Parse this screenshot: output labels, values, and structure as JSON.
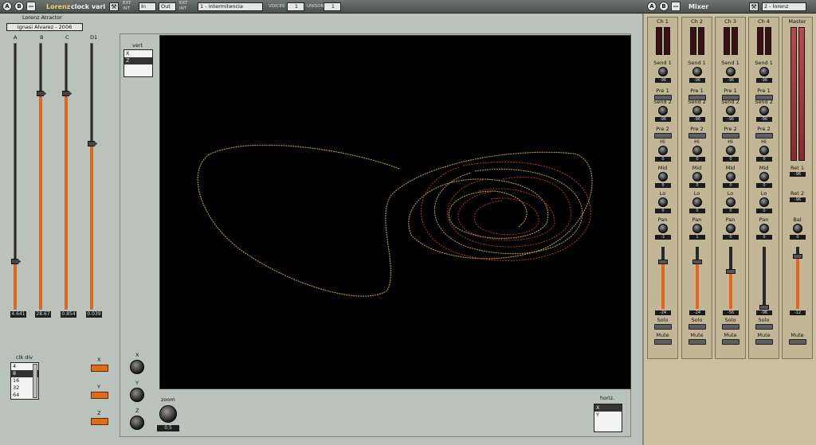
{
  "lorenz": {
    "title": "Lorenz",
    "title_suffix": "clock vari",
    "in_label": "In",
    "out_label": "Out",
    "ext": "EXT",
    "int": "INT",
    "patch": "1 - intermitencia",
    "voices_label": "VOICES",
    "voices": "1",
    "unison_label": "UNISON",
    "unison": "1",
    "panel_title": "Lorenz Atractor",
    "author": "Ignasi Alvarez - 2006",
    "params": [
      {
        "label": "A",
        "value": "4.641",
        "level": 0.18
      },
      {
        "label": "B",
        "value": "28.67",
        "level": 0.81
      },
      {
        "label": "C",
        "value": "0.854",
        "level": 0.81
      },
      {
        "label": "D1",
        "value": "0.039",
        "level": 0.62
      }
    ],
    "clk_div_label": "clk div",
    "clk_div_options": [
      "4",
      "8",
      "16",
      "32",
      "64"
    ],
    "clk_div_selected": 1,
    "x_label": "X",
    "y_label": "Y",
    "z_label": "Z",
    "vert_label": "vert",
    "vert_options": [
      "X",
      "Z"
    ],
    "vert_selected": 1,
    "horiz_label": "horiz.",
    "horiz_options": [
      "X",
      "Y"
    ],
    "horiz_selected": 0,
    "knob_x_label": "X",
    "knob_y_label": "Y",
    "knob_z_label": "Z",
    "zoom_label": "zoom",
    "zoom_value": "0.5"
  },
  "mixer": {
    "title": "Mixer",
    "patch": "2 - lorenz",
    "send1": "Send 1",
    "pre1": "Pre 1",
    "send2": "Send 2",
    "pre2": "Pre 2",
    "hi": "Hi",
    "mid": "Mid",
    "lo": "Lo",
    "pan": "Pan",
    "solo": "Solo",
    "mute": "Mute",
    "ret1": "Ret 1",
    "ret2": "Ret 2",
    "bal": "Bal",
    "channels": [
      {
        "name": "Ch 1",
        "send1": "-96",
        "send2": "-96",
        "hi": "0",
        "mid": "0",
        "lo": "0",
        "pan": "-1",
        "level": "-24",
        "fader": 0.75
      },
      {
        "name": "Ch 2",
        "send1": "-96",
        "send2": "-96",
        "hi": "0",
        "mid": "0",
        "lo": "0",
        "pan": "1",
        "level": "-24",
        "fader": 0.75
      },
      {
        "name": "Ch 3",
        "send1": "-96",
        "send2": "-96",
        "hi": "0",
        "mid": "0",
        "lo": "0",
        "pan": "0",
        "level": "-56",
        "fader": 0.6
      },
      {
        "name": "Ch 4",
        "send1": "-96",
        "send2": "-96",
        "hi": "0",
        "mid": "0",
        "lo": "0",
        "pan": "0",
        "level": "-96",
        "fader": 0.02
      }
    ],
    "master": {
      "name": "Master",
      "ret1": "-96",
      "ret2": "-96",
      "bal": "0",
      "level": "-12",
      "fader": 0.85
    }
  }
}
